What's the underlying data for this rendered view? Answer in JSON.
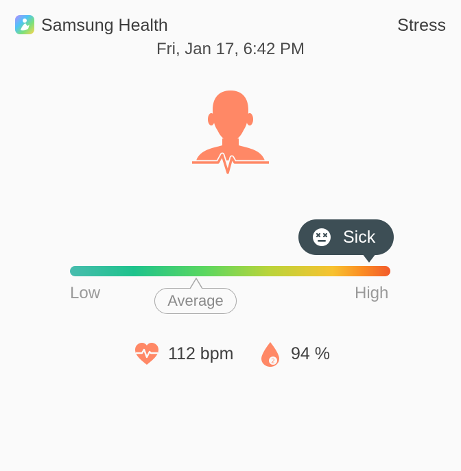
{
  "header": {
    "app_name": "Samsung Health",
    "screen_title": "Stress",
    "datetime": "Fri, Jan 17, 6:42 PM"
  },
  "stress": {
    "level_label": "Sick",
    "level_fraction": 0.94,
    "scale_low": "Low",
    "scale_high": "High",
    "average_label": "Average",
    "average_fraction": 0.39
  },
  "vitals": {
    "heart_rate": "112 bpm",
    "spo2": "94 %"
  },
  "colors": {
    "accent": "#ff8866",
    "bubble": "#3d4e55",
    "background": "#fafafa"
  },
  "icons": [
    "app-icon",
    "person-pulse-icon",
    "sick-face-icon",
    "heart-rate-icon",
    "oxygen-drop-icon"
  ]
}
